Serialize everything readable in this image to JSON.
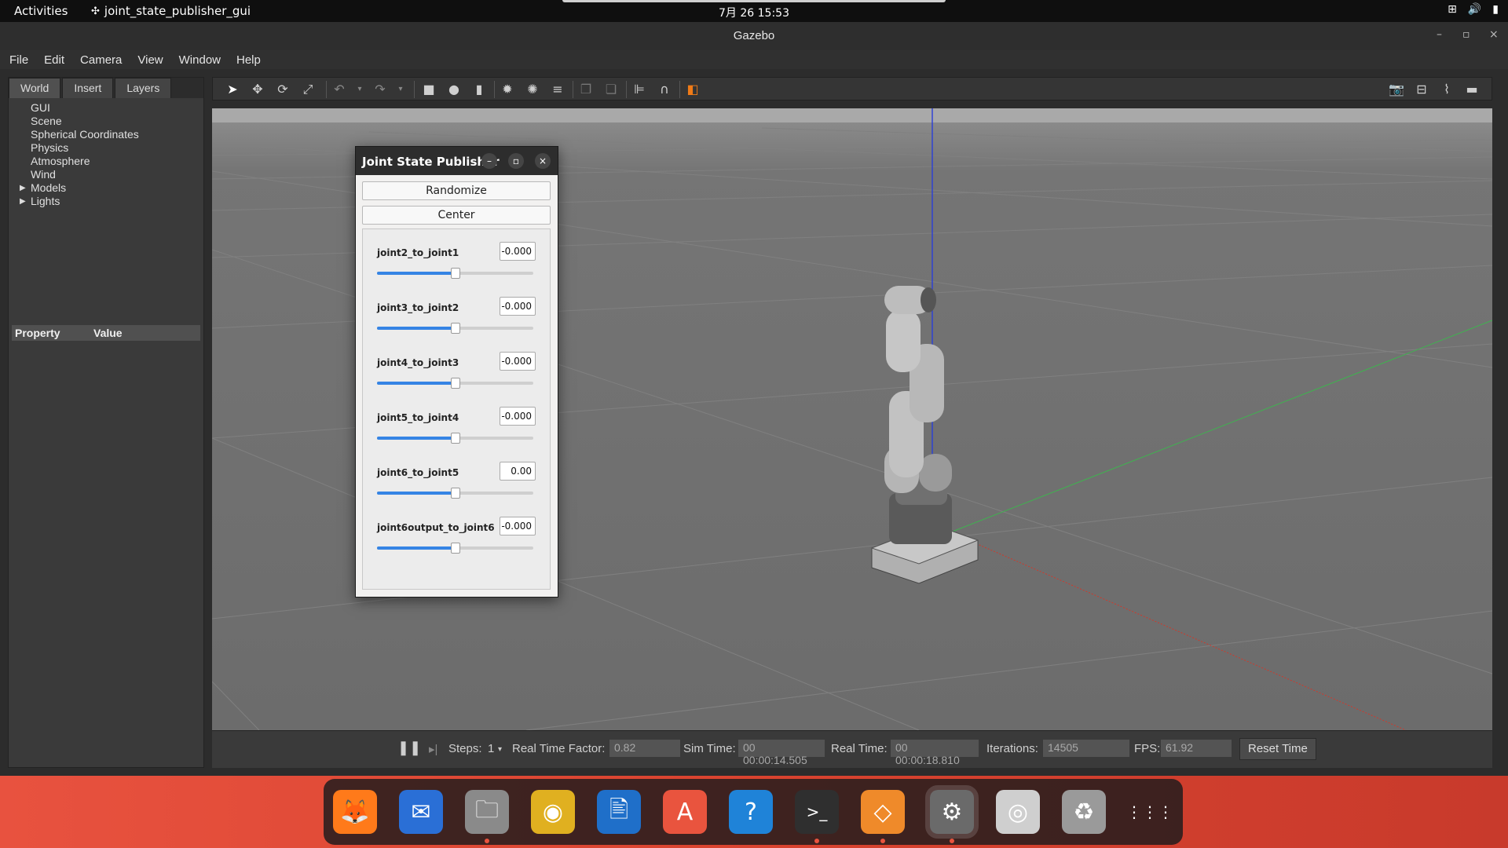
{
  "topbar": {
    "activities": "Activities",
    "app_name": "joint_state_publisher_gui",
    "clock": "7月 26  15:53"
  },
  "window": {
    "title": "Gazebo",
    "minimize": "–",
    "maximize": "▫",
    "close": "×"
  },
  "menu": [
    "File",
    "Edit",
    "Camera",
    "View",
    "Window",
    "Help"
  ],
  "left_panel": {
    "tabs": [
      "World",
      "Insert",
      "Layers"
    ],
    "tree": [
      {
        "label": "GUI",
        "expandable": false
      },
      {
        "label": "Scene",
        "expandable": false
      },
      {
        "label": "Spherical Coordinates",
        "expandable": false
      },
      {
        "label": "Physics",
        "expandable": false
      },
      {
        "label": "Atmosphere",
        "expandable": false
      },
      {
        "label": "Wind",
        "expandable": false
      },
      {
        "label": "Models",
        "expandable": true
      },
      {
        "label": "Lights",
        "expandable": true
      }
    ],
    "property_header": {
      "property": "Property",
      "value": "Value"
    }
  },
  "toolbar": {
    "tools": [
      "select-icon",
      "translate-icon",
      "rotate-icon",
      "scale-icon",
      "undo-icon",
      "redo-icon",
      "box-icon",
      "sphere-icon",
      "cylinder-icon",
      "point-light-icon",
      "spot-light-icon",
      "directional-light-icon",
      "copy-icon",
      "paste-icon",
      "align-icon",
      "snap-icon",
      "view-angle-icon"
    ],
    "right_tools": [
      "screenshot-icon",
      "log-icon",
      "plot-icon",
      "record-icon"
    ]
  },
  "status": {
    "steps_label": "Steps:",
    "steps_value": "1",
    "rtf_label": "Real Time Factor:",
    "rtf_value": "0.82",
    "sim_time_label": "Sim Time:",
    "sim_time_value": "00 00:00:14.505",
    "real_time_label": "Real Time:",
    "real_time_value": "00 00:00:18.810",
    "iterations_label": "Iterations:",
    "iterations_value": "14505",
    "fps_label": "FPS:",
    "fps_value": "61.92",
    "reset_label": "Reset Time"
  },
  "jsp": {
    "title": "Joint State Publisher",
    "randomize": "Randomize",
    "center": "Center",
    "joints": [
      {
        "name": "joint2_to_joint1",
        "value": "-0.000",
        "position": 0.5
      },
      {
        "name": "joint3_to_joint2",
        "value": "-0.000",
        "position": 0.5
      },
      {
        "name": "joint4_to_joint3",
        "value": "-0.000",
        "position": 0.5
      },
      {
        "name": "joint5_to_joint4",
        "value": "-0.000",
        "position": 0.5
      },
      {
        "name": "joint6_to_joint5",
        "value": "0.00",
        "position": 0.5
      },
      {
        "name": "joint6output_to_joint6",
        "value": "-0.000",
        "position": 0.5
      }
    ]
  },
  "dock": {
    "apps": [
      "firefox-icon",
      "thunderbird-icon",
      "files-icon",
      "rhythmbox-icon",
      "writer-icon",
      "app-center-icon",
      "help-icon",
      "terminal-icon",
      "package-icon",
      "settings-icon",
      "disc-icon",
      "trash-icon",
      "app-grid-icon"
    ],
    "accent": "#e9543e"
  },
  "colors": {
    "axis_x": "#d0392b",
    "axis_y": "#3fb34f",
    "axis_z": "#2a3fd8",
    "slider_fill": "#3584e4"
  }
}
